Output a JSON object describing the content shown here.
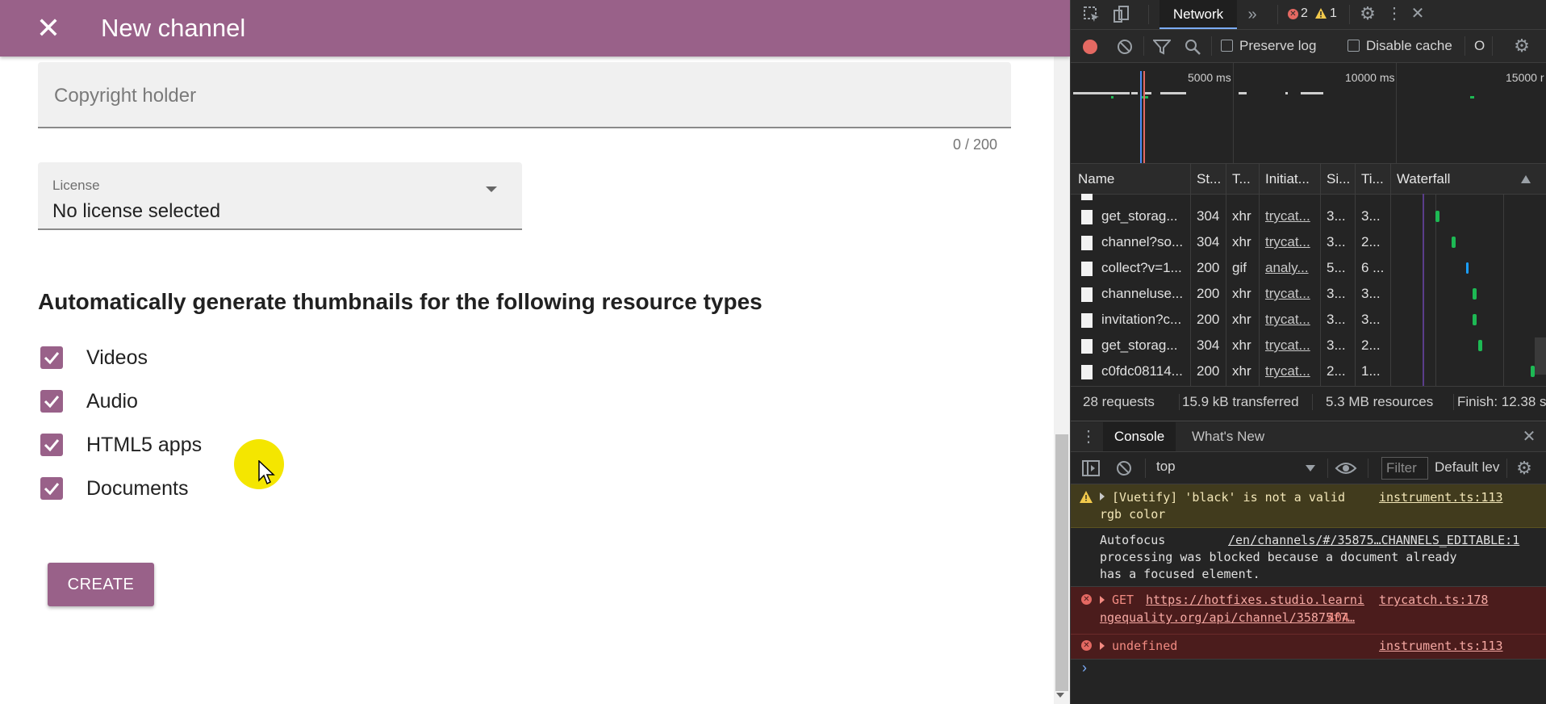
{
  "app": {
    "title": "New channel",
    "copyright": {
      "placeholder": "Copyright holder",
      "counter": "0 / 200"
    },
    "license": {
      "label": "License",
      "value": "No license selected"
    },
    "thumbnails_heading": "Automatically generate thumbnails for the following resource types",
    "checkboxes": [
      {
        "label": "Videos",
        "checked": true
      },
      {
        "label": "Audio",
        "checked": true
      },
      {
        "label": "HTML5 apps",
        "checked": true
      },
      {
        "label": "Documents",
        "checked": true
      }
    ],
    "create_label": "CREATE",
    "colors": {
      "brand": "#996189"
    }
  },
  "devtools": {
    "tabs": {
      "network": "Network",
      "errors": "2",
      "warnings": "1"
    },
    "toolbar": {
      "preserve_log": "Preserve log",
      "disable_cache": "Disable cache",
      "online": "O"
    },
    "timeline": {
      "t1": "5000 ms",
      "t2": "10000 ms",
      "t3": "15000 r"
    },
    "columns": {
      "name": "Name",
      "status": "St...",
      "type": "T...",
      "initiator": "Initiat...",
      "size": "Si...",
      "time": "Ti...",
      "waterfall": "Waterfall"
    },
    "requests": [
      {
        "name": "get_storag...",
        "status": "304",
        "type": "xhr",
        "initiator": "trycat...",
        "size": "3...",
        "time": "3...",
        "bar_color": "#1db954"
      },
      {
        "name": "channel?so...",
        "status": "304",
        "type": "xhr",
        "initiator": "trycat...",
        "size": "3...",
        "time": "2...",
        "bar_color": "#1db954"
      },
      {
        "name": "collect?v=1...",
        "status": "200",
        "type": "gif",
        "initiator": "analy...",
        "size": "5...",
        "time": "6 ...",
        "bar_color": "#1a9fff"
      },
      {
        "name": "channeluse...",
        "status": "200",
        "type": "xhr",
        "initiator": "trycat...",
        "size": "3...",
        "time": "3...",
        "bar_color": "#1db954"
      },
      {
        "name": "invitation?c...",
        "status": "200",
        "type": "xhr",
        "initiator": "trycat...",
        "size": "3...",
        "time": "3...",
        "bar_color": "#1db954"
      },
      {
        "name": "get_storag...",
        "status": "304",
        "type": "xhr",
        "initiator": "trycat...",
        "size": "3...",
        "time": "2...",
        "bar_color": "#1db954"
      },
      {
        "name": "c0fdc08114...",
        "status": "200",
        "type": "xhr",
        "initiator": "trycat...",
        "size": "2...",
        "time": "1...",
        "bar_color": "#1db954"
      }
    ],
    "summary": {
      "requests": "28 requests",
      "transferred": "15.9 kB transferred",
      "resources": "5.3 MB resources",
      "finish": "Finish: 12.38 s"
    },
    "drawer": {
      "console_tab": "Console",
      "whats_new_tab": "What's New"
    },
    "console_toolbar": {
      "context": "top",
      "filter_placeholder": "Filter",
      "levels": "Default lev"
    },
    "messages": {
      "warn1_line1": "[Vuetify] 'black' is not a valid",
      "warn1_line2": "rgb color",
      "warn1_src": "instrument.ts:113",
      "info1_line1": "Autofocus",
      "info1_src": "/en/channels/#/35875…CHANNELS_EDITABLE:1",
      "info1_line2": "processing was blocked because a document already",
      "info1_line3": "has a focused element.",
      "err1_method": "GET",
      "err1_url1": "https://hotfixes.studio.learni",
      "err1_url2": "ngequality.org/api/channel/35875f7…",
      "err1_code": "404",
      "err1_src": "trycatch.ts:178",
      "err2_text": "undefined",
      "err2_src": "instrument.ts:113"
    },
    "colors": {
      "selected_tab_underline": "#7cacf8",
      "error": "#e46962",
      "warning": "#f2c94c"
    }
  }
}
